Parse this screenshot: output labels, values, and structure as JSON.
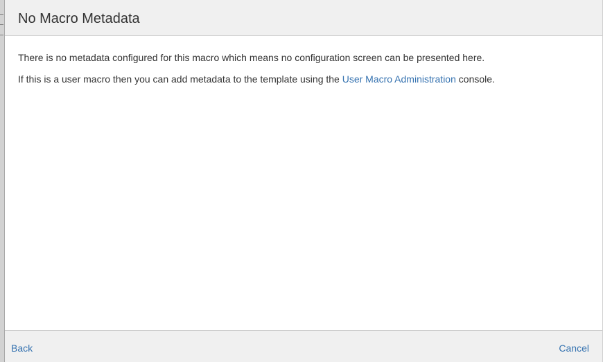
{
  "dialog": {
    "title": "No Macro Metadata",
    "body": {
      "paragraph1": "There is no metadata configured for this macro which means no configuration screen can be presented here.",
      "paragraph2_prefix": "If this is a user macro then you can add metadata to the template using the ",
      "paragraph2_link": "User Macro Administration",
      "paragraph2_suffix": " console."
    },
    "footer": {
      "back_label": "Back",
      "cancel_label": "Cancel"
    }
  },
  "colors": {
    "link": "#3572b0",
    "text": "#333333",
    "header_bg": "#f0f0f0"
  }
}
